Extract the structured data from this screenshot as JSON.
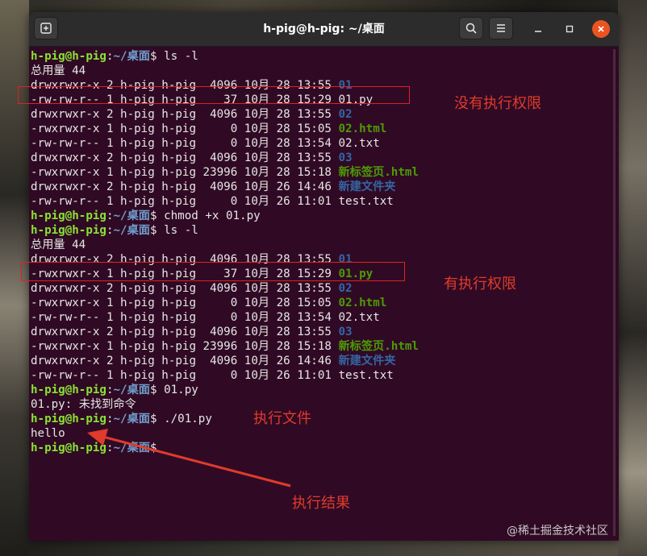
{
  "window": {
    "title": "h-pig@h-pig: ~/桌面"
  },
  "prompt": {
    "user": "h-pig@h-pig",
    "colon": ":",
    "path": "~/桌面",
    "symbol": "$ "
  },
  "terminal": {
    "lines": [
      {
        "type": "prompt",
        "cmd": "ls -l"
      },
      {
        "type": "text",
        "text": "总用量 44"
      },
      {
        "type": "ls",
        "perm": "drwxrwxr-x 2 h-pig h-pig  4096 10月 28 13:55 ",
        "name": "01",
        "kind": "dir"
      },
      {
        "type": "ls",
        "perm": "-rw-rw-r-- 1 h-pig h-pig    37 10月 28 15:29 ",
        "name": "01.py",
        "kind": "file"
      },
      {
        "type": "ls",
        "perm": "drwxrwxr-x 2 h-pig h-pig  4096 10月 28 13:55 ",
        "name": "02",
        "kind": "dir"
      },
      {
        "type": "ls",
        "perm": "-rwxrwxr-x 1 h-pig h-pig     0 10月 28 15:05 ",
        "name": "02.html",
        "kind": "exe"
      },
      {
        "type": "ls",
        "perm": "-rw-rw-r-- 1 h-pig h-pig     0 10月 28 13:54 ",
        "name": "02.txt",
        "kind": "file"
      },
      {
        "type": "ls",
        "perm": "drwxrwxr-x 2 h-pig h-pig  4096 10月 28 13:55 ",
        "name": "03",
        "kind": "dir"
      },
      {
        "type": "ls",
        "perm": "-rwxrwxr-x 1 h-pig h-pig 23996 10月 28 15:18 ",
        "name": "新标签页.html",
        "kind": "exe"
      },
      {
        "type": "ls",
        "perm": "drwxrwxr-x 2 h-pig h-pig  4096 10月 26 14:46 ",
        "name": "新建文件夹",
        "kind": "dir"
      },
      {
        "type": "ls",
        "perm": "-rw-rw-r-- 1 h-pig h-pig     0 10月 26 11:01 ",
        "name": "test.txt",
        "kind": "file"
      },
      {
        "type": "prompt",
        "cmd": "chmod +x 01.py"
      },
      {
        "type": "prompt",
        "cmd": "ls -l"
      },
      {
        "type": "text",
        "text": "总用量 44"
      },
      {
        "type": "ls",
        "perm": "drwxrwxr-x 2 h-pig h-pig  4096 10月 28 13:55 ",
        "name": "01",
        "kind": "dir"
      },
      {
        "type": "ls",
        "perm": "-rwxrwxr-x 1 h-pig h-pig    37 10月 28 15:29 ",
        "name": "01.py",
        "kind": "exe"
      },
      {
        "type": "ls",
        "perm": "drwxrwxr-x 2 h-pig h-pig  4096 10月 28 13:55 ",
        "name": "02",
        "kind": "dir"
      },
      {
        "type": "ls",
        "perm": "-rwxrwxr-x 1 h-pig h-pig     0 10月 28 15:05 ",
        "name": "02.html",
        "kind": "exe"
      },
      {
        "type": "ls",
        "perm": "-rw-rw-r-- 1 h-pig h-pig     0 10月 28 13:54 ",
        "name": "02.txt",
        "kind": "file"
      },
      {
        "type": "ls",
        "perm": "drwxrwxr-x 2 h-pig h-pig  4096 10月 28 13:55 ",
        "name": "03",
        "kind": "dir"
      },
      {
        "type": "ls",
        "perm": "-rwxrwxr-x 1 h-pig h-pig 23996 10月 28 15:18 ",
        "name": "新标签页.html",
        "kind": "exe"
      },
      {
        "type": "ls",
        "perm": "drwxrwxr-x 2 h-pig h-pig  4096 10月 26 14:46 ",
        "name": "新建文件夹",
        "kind": "dir"
      },
      {
        "type": "ls",
        "perm": "-rw-rw-r-- 1 h-pig h-pig     0 10月 26 11:01 ",
        "name": "test.txt",
        "kind": "file"
      },
      {
        "type": "prompt",
        "cmd": "01.py"
      },
      {
        "type": "text",
        "text": "01.py: 未找到命令"
      },
      {
        "type": "prompt",
        "cmd": "./01.py"
      },
      {
        "type": "text",
        "text": "hello"
      },
      {
        "type": "prompt",
        "cmd": ""
      }
    ]
  },
  "annotations": {
    "no_exec": "没有执行权限",
    "has_exec": "有执行权限",
    "exec_file": "执行文件",
    "exec_result": "执行结果"
  },
  "watermark": "@稀土掘金技术社区",
  "colors": {
    "terminal_bg": "#300a24",
    "prompt_user": "#8ae234",
    "prompt_path": "#729fcf",
    "dir": "#3465a4",
    "exe": "#4e9a06",
    "annotation": "#e03b2c",
    "close_button": "#e95420"
  },
  "icons": {
    "new_tab": "new-tab-icon",
    "search": "search-icon",
    "menu": "hamburger-menu-icon",
    "minimize": "minimize-icon",
    "maximize": "maximize-icon",
    "close": "close-icon"
  }
}
